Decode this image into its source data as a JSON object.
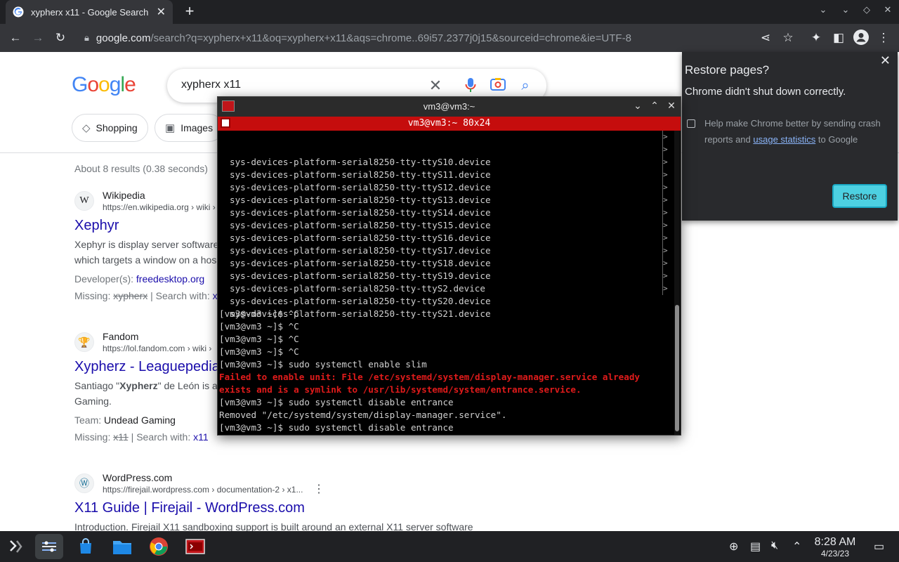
{
  "browser": {
    "tab_title": "xypherx x11 - Google Search",
    "tab_close": "✕",
    "new_tab": "+",
    "url_domain": "google.com",
    "url_path": "/search?q=xypherx+x11&oq=xypherx+x11&aqs=chrome..69i57.2377j0j15&sourceid=chrome&ie=UTF-8"
  },
  "google": {
    "logo": [
      "G",
      "o",
      "o",
      "g",
      "l",
      "e"
    ],
    "query": "xypherx x11",
    "chips": [
      {
        "label": "Shopping",
        "icon": "tag-icon"
      },
      {
        "label": "Images",
        "icon": "image-icon"
      }
    ],
    "stats": "About 8 results (0.38 seconds)",
    "results": [
      {
        "site": "Wikipedia",
        "icon_glyph": "W",
        "url": "https://en.wikipedia.org › wiki ›",
        "title": "Xephyr",
        "snippet": [
          "Xephyr is display server software",
          "which targets a window on a hos"
        ],
        "meta1_label": "Developer(s): ",
        "meta1_link": "freedesktop.org",
        "missing_label": "Missing: ",
        "missing_word": "xypherx",
        "search_with_label": " | Search with: ",
        "search_with_link": "xy"
      },
      {
        "site": "Fandom",
        "icon_glyph": "🏆",
        "url": "https://lol.fandom.com › wiki ›",
        "title": "Xypherz - Leaguepedia",
        "snippet_pre": "Santiago \"",
        "snippet_bold": "Xypherz",
        "snippet_post": "\" de León is a",
        "snippet2": "Gaming.",
        "team_label": "Team: ",
        "team_value": "Undead Gaming",
        "missing_label": "Missing: ",
        "missing_word": "x11",
        "search_with_label": " | Search with: ",
        "search_with_link": "x11"
      },
      {
        "site": "WordPress.com",
        "icon_glyph": "Ⓦ",
        "url": "https://firejail.wordpress.com › documentation-2 › x1...",
        "kebab": "⋮",
        "title": "X11 Guide | Firejail - WordPress.com",
        "snippet": "Introduction. Firejail X11 sandboxing support is built around an external X11 server software"
      }
    ]
  },
  "restore": {
    "title": "Restore pages?",
    "subtitle": "Chrome didn't shut down correctly.",
    "help_text": "Help make Chrome better by sending crash reports and ",
    "help_link": "usage statistics",
    "help_tail": " to Google",
    "button": "Restore",
    "close": "✕",
    "accent": "#4dd0e1"
  },
  "terminal": {
    "title": "vm3@vm3:~",
    "subtitle": "vm3@vm3:~ 80x24",
    "device_lines": [
      "sys-devices-platform-serial8250-tty-ttyS10.device",
      "sys-devices-platform-serial8250-tty-ttyS11.device",
      "sys-devices-platform-serial8250-tty-ttyS12.device",
      "sys-devices-platform-serial8250-tty-ttyS13.device",
      "sys-devices-platform-serial8250-tty-ttyS14.device",
      "sys-devices-platform-serial8250-tty-ttyS15.device",
      "sys-devices-platform-serial8250-tty-ttyS16.device",
      "sys-devices-platform-serial8250-tty-ttyS17.device",
      "sys-devices-platform-serial8250-tty-ttyS18.device",
      "sys-devices-platform-serial8250-tty-ttyS19.device",
      "sys-devices-platform-serial8250-tty-ttyS2.device",
      "sys-devices-platform-serial8250-tty-ttyS20.device",
      "sys-devices-platform-serial8250-tty-ttyS21.device"
    ],
    "shell_lines": [
      {
        "text": "[vm3@vm3 ~]$ ^C",
        "error": false
      },
      {
        "text": "[vm3@vm3 ~]$ ^C",
        "error": false
      },
      {
        "text": "[vm3@vm3 ~]$ ^C",
        "error": false
      },
      {
        "text": "[vm3@vm3 ~]$ ^C",
        "error": false
      },
      {
        "text": "[vm3@vm3 ~]$ sudo systemctl enable slim",
        "error": false
      },
      {
        "text": "Failed to enable unit: File /etc/systemd/system/display-manager.service already",
        "error": true
      },
      {
        "text": "exists and is a symlink to /usr/lib/systemd/system/entrance.service.",
        "error": true
      },
      {
        "text": "[vm3@vm3 ~]$ sudo systemctl disable entrance",
        "error": false
      },
      {
        "text": "Removed \"/etc/systemd/system/display-manager.service\".",
        "error": false
      },
      {
        "text": "[vm3@vm3 ~]$ sudo systemctl disable entrance",
        "error": false
      }
    ],
    "error_color": "#e01b1b",
    "titlebar_color": "#c50d0d"
  },
  "taskbar": {
    "time": "8:28 AM",
    "date": "4/23/23"
  }
}
